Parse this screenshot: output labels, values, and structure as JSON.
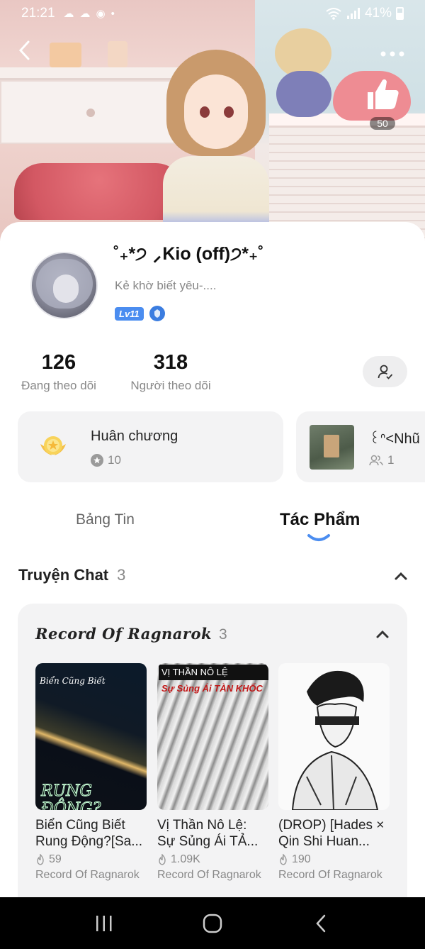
{
  "status_bar": {
    "time": "21:21",
    "battery": "41%"
  },
  "header": {
    "likes": "50"
  },
  "profile": {
    "nickname": "˚₊*੭ ⸝Kio (off)੭*₊˚",
    "bio": "Kẻ khờ biết yêu-....",
    "level": "Lv11",
    "stats": [
      {
        "value": "126",
        "label": "Đang theo dõi"
      },
      {
        "value": "318",
        "label": "Người theo dõi"
      }
    ]
  },
  "cards": {
    "medals": {
      "title": "Huân chương",
      "count": "10"
    },
    "group": {
      "title": "꒰ᐢ<Nhũ",
      "members": "1"
    }
  },
  "tabs": [
    {
      "label": "Bảng Tin",
      "active": false
    },
    {
      "label": "Tác Phẩm",
      "active": true
    }
  ],
  "section": {
    "title": "Truyện Chat",
    "count": "3"
  },
  "story_group": {
    "name": "Record Of Ragnarok",
    "count": "3",
    "stories": [
      {
        "title": "Biển Cũng Biết Rung Động?[Sa...",
        "views": "59",
        "group": "Record Of Ragnarok",
        "cover_text_top": "Biển Cũng Biết",
        "cover_text_bottom": "RUNG ĐỘNG?"
      },
      {
        "title": "Vị Thần Nô Lệ: Sự Sủng Ái TẢ...",
        "views": "1.09K",
        "group": "Record Of Ragnarok",
        "cover_text_top": "VỊ THẦN NÔ LỆ",
        "cover_text_bottom": "Sự Sủng Ái TÀN KHỐC"
      },
      {
        "title": "(DROP) [Hades × Qin Shi Huan...",
        "views": "190",
        "group": "Record Of Ragnarok"
      }
    ]
  },
  "colors": {
    "accent": "#4b8df0",
    "card_bg": "#f3f3f4",
    "muted_text": "#888888"
  }
}
